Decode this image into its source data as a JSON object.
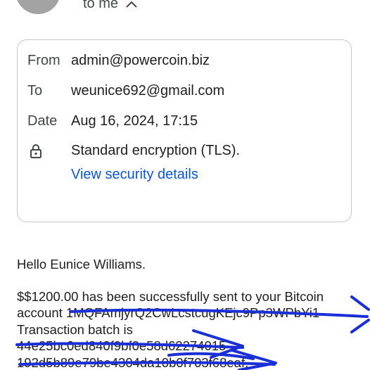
{
  "header": {
    "recipient_toggle": "to me"
  },
  "details": {
    "from_label": "From",
    "from_value": "admin@powercoin.biz",
    "to_label": "To",
    "to_value": "weunice692@gmail.com",
    "date_label": "Date",
    "date_value": "Aug 16, 2024, 17:15",
    "encryption_value": "Standard encryption (TLS).",
    "security_link": "View security details"
  },
  "message": {
    "greeting": "Hello Eunice Williams.",
    "line1": "$$1200.00 has been successfully sent to your Bitcoin",
    "line2": "account 1MQFAmjyrQ2CwLcstcugKEjc9Pp3WPbYi1",
    "line3": "Transaction batch is",
    "line4": "44e25bc0ed840f9bf0e58d62274015",
    "line5": "192d5b89e79be4304da10b0f703f68eaf."
  },
  "annotations": {
    "scribble_color": "#1a2fd6"
  }
}
